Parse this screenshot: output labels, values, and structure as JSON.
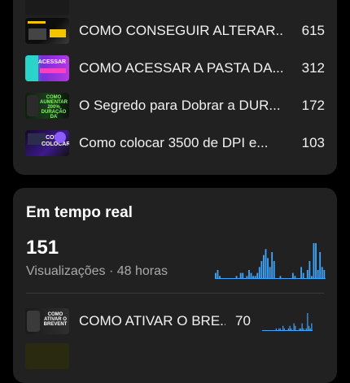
{
  "top_list": {
    "rows": [
      {
        "title": "COMO CONSEGUIR ALTERAR...",
        "value": "615"
      },
      {
        "title": "COMO ACESSAR A PASTA DA...",
        "value": "312"
      },
      {
        "title": "O Segredo para Dobrar a DUR...",
        "value": "172"
      },
      {
        "title": "Como colocar 3500 de DPI e...",
        "value": "103"
      }
    ],
    "thumb_texts": {
      "acessar": "ACESSAR",
      "aumentar": "COMO AUMENTAR 200% DURAÇÃO DA BATERIA",
      "colocar": "COMO COLOCAR"
    }
  },
  "realtime": {
    "title": "Em tempo real",
    "views": "151",
    "label": "Visualizações · 48 horas",
    "rows": [
      {
        "title": "COMO ATIVAR O BRE...",
        "value": "70",
        "thumb_text": "COMO ATIVAR O BREVENT"
      }
    ]
  },
  "chart_data": [
    {
      "type": "bar",
      "values": [
        2,
        3,
        1,
        0,
        0,
        0,
        0,
        0,
        0,
        0,
        1,
        0,
        2,
        2,
        0,
        1,
        3,
        2,
        1,
        1,
        2,
        4,
        6,
        8,
        10,
        7,
        4,
        9,
        6,
        0,
        0,
        1,
        0,
        0,
        0,
        0,
        0,
        2,
        1,
        0,
        0,
        4,
        2,
        0,
        3,
        6,
        1,
        12,
        12,
        3,
        9,
        4,
        3
      ]
    },
    {
      "type": "bar",
      "values": [
        0,
        0,
        0,
        0,
        0,
        0,
        0,
        0,
        0,
        0,
        1,
        0,
        1,
        1,
        0,
        2,
        1,
        0,
        0,
        1,
        2,
        1,
        0,
        3,
        2,
        0,
        0,
        1,
        1,
        3,
        1,
        0,
        1,
        7,
        2,
        1,
        3
      ]
    }
  ],
  "colors": {
    "card": "#212121",
    "bar": "#3ea6ff",
    "muted": "#aaaaaa"
  }
}
